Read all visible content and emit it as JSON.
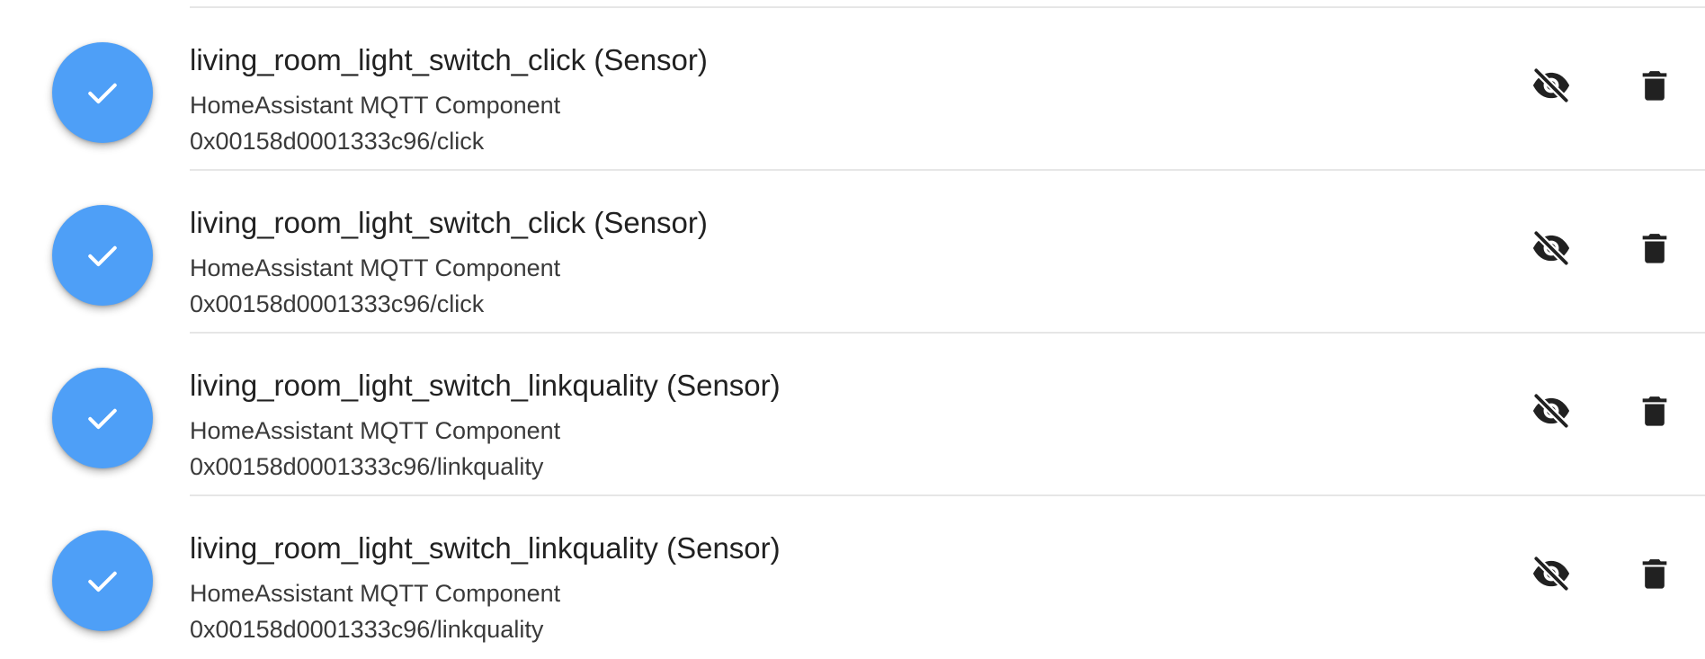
{
  "entities": [
    {
      "title": "living_room_light_switch_click (Sensor)",
      "subtitle": "HomeAssistant MQTT Component",
      "topic": "0x00158d0001333c96/click"
    },
    {
      "title": "living_room_light_switch_click (Sensor)",
      "subtitle": "HomeAssistant MQTT Component",
      "topic": "0x00158d0001333c96/click"
    },
    {
      "title": "living_room_light_switch_linkquality (Sensor)",
      "subtitle": "HomeAssistant MQTT Component",
      "topic": "0x00158d0001333c96/linkquality"
    },
    {
      "title": "living_room_light_switch_linkquality (Sensor)",
      "subtitle": "HomeAssistant MQTT Component",
      "topic": "0x00158d0001333c96/linkquality"
    }
  ],
  "icons": {
    "selected": "check-icon",
    "visibility": "eye-off-icon",
    "delete": "trash-icon"
  },
  "colors": {
    "accent": "#4e9ff7",
    "icon": "#212121",
    "divider": "#e6e6e6"
  }
}
